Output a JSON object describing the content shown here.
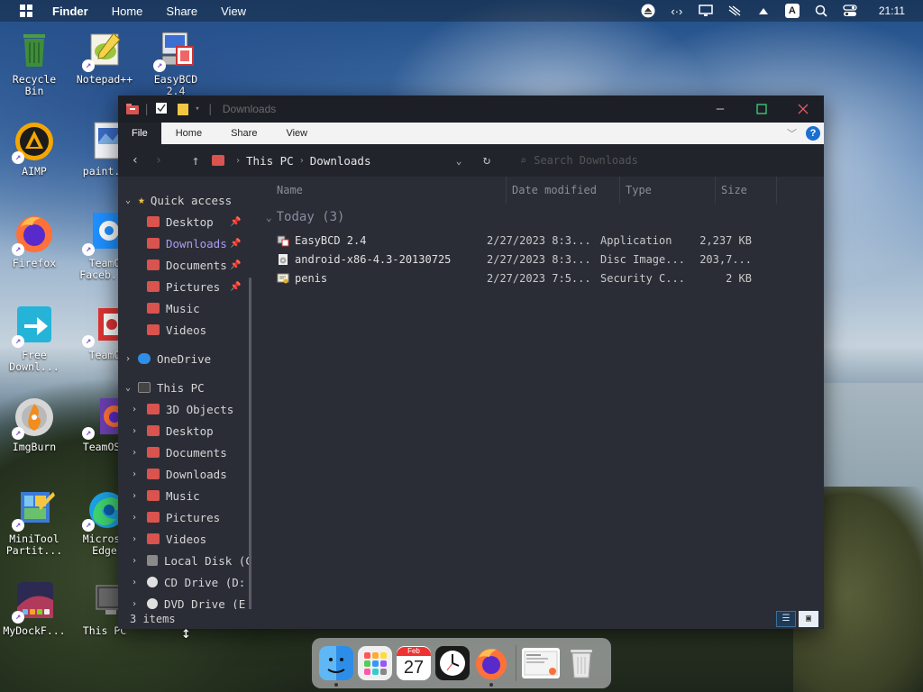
{
  "menubar": {
    "app": "Finder",
    "items": [
      "Home",
      "Share",
      "View"
    ],
    "clock": "21:11",
    "input_indicator": "A"
  },
  "desktop_icons": [
    {
      "label": "Recycle Bin",
      "icon": "recycle-bin-icon",
      "color": "#3f8d3c"
    },
    {
      "label": "Notepad++",
      "icon": "notepadpp-icon",
      "color": "#9bc53d"
    },
    {
      "label": "EasyBCD 2.4",
      "icon": "easybcd-icon",
      "color": "#3b6fd1"
    },
    {
      "label": "AIMP",
      "icon": "aimp-icon",
      "color": "#f4a700"
    },
    {
      "label": "paint.n",
      "icon": "paint-icon",
      "color": "#cfd8e6"
    },
    {
      "label": "Firefox",
      "icon": "firefox-icon",
      "color": "#ff7139"
    },
    {
      "label": "TeamO Faceb...",
      "icon": "teamos-gear-icon",
      "color": "#1e90ff"
    },
    {
      "label": "Free Downl...",
      "icon": "free-download-icon",
      "color": "#25b4d8"
    },
    {
      "label": "TeamO",
      "icon": "teamos-icon",
      "color": "#d33"
    },
    {
      "label": "ImgBurn",
      "icon": "imgburn-icon",
      "color": "#c8c8c8"
    },
    {
      "label": "TeamOS.",
      "icon": "teamos-firefox-icon",
      "color": "#6b3fb0"
    },
    {
      "label": "MiniTool Partit...",
      "icon": "minitool-icon",
      "color": "#3c7ad6"
    },
    {
      "label": "Microso Edge",
      "icon": "edge-icon",
      "color": "#1ba1e2"
    },
    {
      "label": "MyDockF...",
      "icon": "mydock-icon",
      "color": "#b03a5b"
    },
    {
      "label": "This PC",
      "icon": "this-pc-icon",
      "color": "#555"
    }
  ],
  "window": {
    "title": "Downloads",
    "ribbon_tabs": [
      "File",
      "Home",
      "Share",
      "View"
    ],
    "breadcrumb": [
      "This PC",
      "Downloads"
    ],
    "search_placeholder": "Search Downloads",
    "columns": [
      "Name",
      "Date modified",
      "Type",
      "Size"
    ],
    "group_label": "Today (3)",
    "files": [
      {
        "name": "EasyBCD 2.4",
        "date": "2/27/2023 8:3...",
        "type": "Application",
        "size": "2,237 KB",
        "icon": "easybcd-file-icon"
      },
      {
        "name": "android-x86-4.3-20130725",
        "date": "2/27/2023 8:3...",
        "type": "Disc Image...",
        "size": "203,7...",
        "icon": "disc-image-icon"
      },
      {
        "name": "penis",
        "date": "2/27/2023 7:5...",
        "type": "Security C...",
        "size": "2 KB",
        "icon": "certificate-icon"
      }
    ],
    "status": "3 items",
    "nav": {
      "quick_access": "Quick access",
      "quick_items": [
        {
          "label": "Desktop",
          "pinned": true
        },
        {
          "label": "Downloads",
          "pinned": true
        },
        {
          "label": "Documents",
          "pinned": true
        },
        {
          "label": "Pictures",
          "pinned": true
        },
        {
          "label": "Music",
          "pinned": false
        },
        {
          "label": "Videos",
          "pinned": false
        }
      ],
      "onedrive": "OneDrive",
      "this_pc": "This PC",
      "pc_items": [
        "3D Objects",
        "Desktop",
        "Documents",
        "Downloads",
        "Music",
        "Pictures",
        "Videos",
        "Local Disk (C",
        "CD Drive (D:",
        "DVD Drive (E"
      ]
    }
  },
  "dock": {
    "calendar_month": "Feb",
    "calendar_day": "27"
  }
}
